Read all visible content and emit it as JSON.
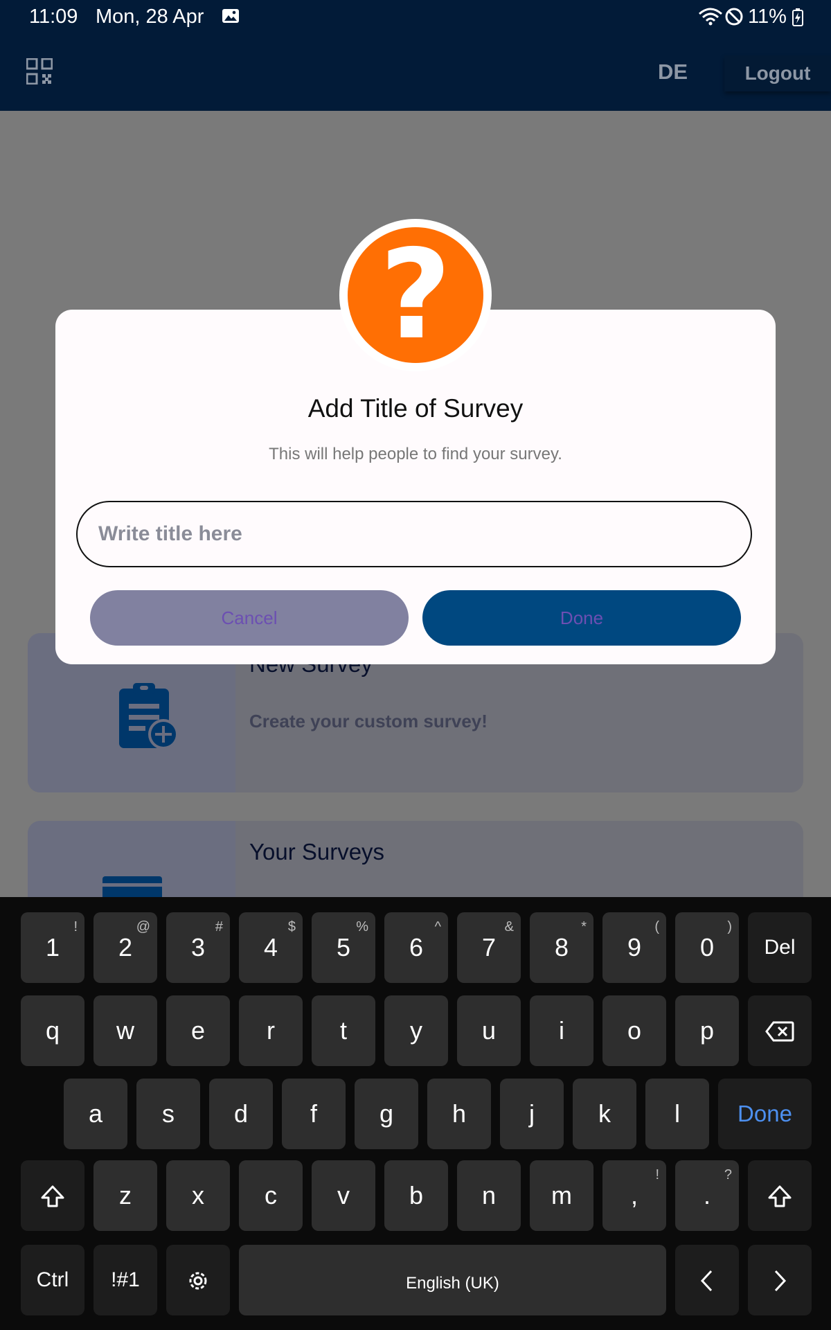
{
  "status_bar": {
    "time": "11:09",
    "date": "Mon, 28 Apr",
    "battery": "11%"
  },
  "app_bar": {
    "language": "DE",
    "logout": "Logout"
  },
  "cards": [
    {
      "title": "New Survey",
      "subtitle": "Create your custom survey!"
    },
    {
      "title": "Your Surveys"
    }
  ],
  "dialog": {
    "title": "Add Title of Survey",
    "subtitle": "This will help people to find your survey.",
    "input_placeholder": "Write title here",
    "cancel": "Cancel",
    "done": "Done"
  },
  "keyboard": {
    "row1": [
      {
        "k": "1",
        "h": "!"
      },
      {
        "k": "2",
        "h": "@"
      },
      {
        "k": "3",
        "h": "#"
      },
      {
        "k": "4",
        "h": "$"
      },
      {
        "k": "5",
        "h": "%"
      },
      {
        "k": "6",
        "h": "^"
      },
      {
        "k": "7",
        "h": "&"
      },
      {
        "k": "8",
        "h": "*"
      },
      {
        "k": "9",
        "h": "("
      },
      {
        "k": "0",
        "h": ")"
      }
    ],
    "del": "Del",
    "row2": [
      "q",
      "w",
      "e",
      "r",
      "t",
      "y",
      "u",
      "i",
      "o",
      "p"
    ],
    "row3": [
      "a",
      "s",
      "d",
      "f",
      "g",
      "h",
      "j",
      "k",
      "l"
    ],
    "done": "Done",
    "row4": [
      {
        "k": "z"
      },
      {
        "k": "x"
      },
      {
        "k": "c"
      },
      {
        "k": "v"
      },
      {
        "k": "b"
      },
      {
        "k": "n"
      },
      {
        "k": "m"
      },
      {
        "k": ",",
        "h": "!"
      },
      {
        "k": ".",
        "h": "?"
      }
    ],
    "ctrl": "Ctrl",
    "symbols": "!#1",
    "space": "English (UK)"
  },
  "colors": {
    "app_bar": "#021b38",
    "accent_orange": "#ff6f04",
    "done_button": "#004880",
    "cancel_button": "#8181a0",
    "keyboard_done_text": "#4d90f0"
  }
}
